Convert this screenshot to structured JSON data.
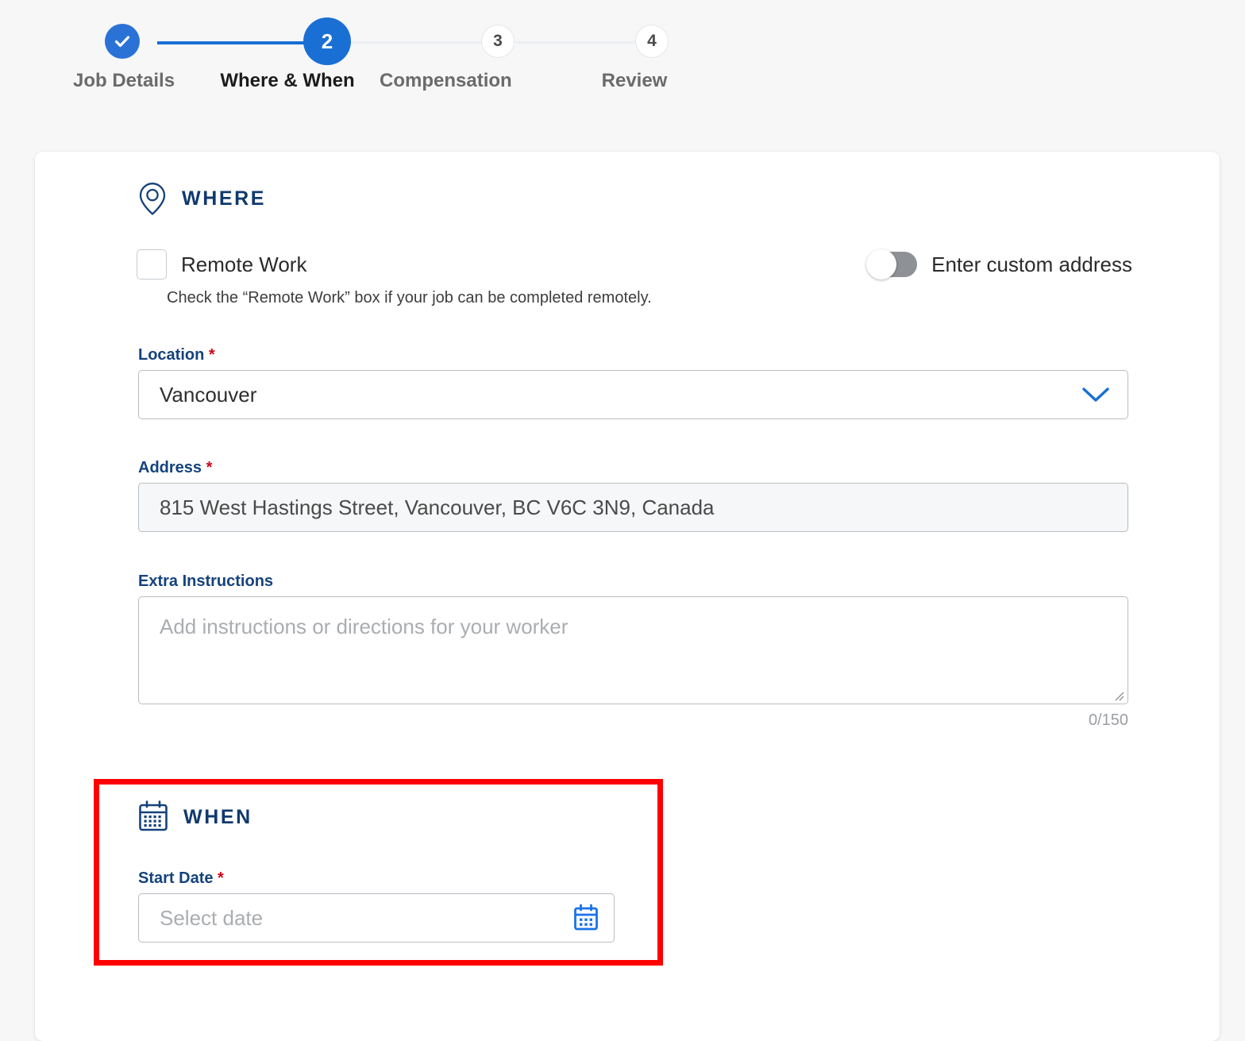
{
  "stepper": {
    "steps": [
      {
        "id": "step-1",
        "indicator": "✓",
        "label": "Job Details",
        "state": "completed"
      },
      {
        "id": "step-2",
        "indicator": "2",
        "label": "Where & When",
        "state": "current"
      },
      {
        "id": "step-3",
        "indicator": "3",
        "label": "Compensation",
        "state": "upcoming"
      },
      {
        "id": "step-4",
        "indicator": "4",
        "label": "Review",
        "state": "upcoming"
      }
    ]
  },
  "where": {
    "title": "WHERE",
    "icon": "map-pin-icon",
    "remote_work": {
      "label": "Remote Work",
      "checked": false,
      "help_text": "Check the “Remote Work” box if your job can be completed remotely."
    },
    "custom_address_toggle": {
      "label": "Enter custom address",
      "enabled": false
    },
    "location": {
      "label": "Location",
      "required_marker": "*",
      "value": "Vancouver",
      "icon": "chevron-down-icon"
    },
    "address": {
      "label": "Address",
      "required_marker": "*",
      "value": "815 West Hastings Street, Vancouver, BC V6C 3N9, Canada"
    },
    "extra_instructions": {
      "label": "Extra Instructions",
      "value": "",
      "placeholder": "Add instructions or directions for your worker",
      "counter": "0/150"
    }
  },
  "when": {
    "title": "WHEN",
    "icon": "calendar-icon",
    "start_date": {
      "label": "Start Date",
      "required_marker": "*",
      "value": "",
      "placeholder": "Select date",
      "icon": "calendar-picker-icon"
    }
  },
  "colors": {
    "accent_blue": "#1a6fd4",
    "navy": "#10396e",
    "required_red": "#d0021b",
    "annotation_red": "#ff0000",
    "page_background": "#f7f7f7",
    "toggle_off_track": "#8e9196"
  }
}
